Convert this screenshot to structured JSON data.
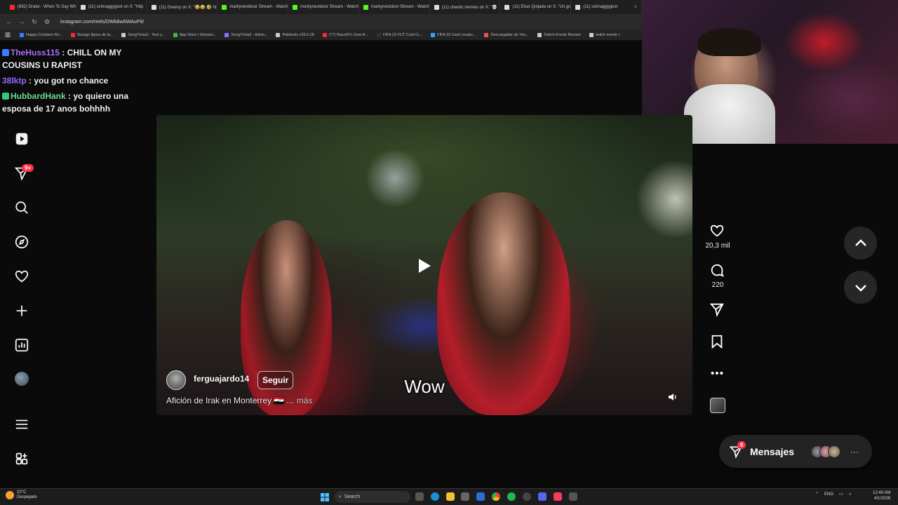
{
  "browser": {
    "tabs": [
      {
        "label": "(682) Drake - When To Say Wh",
        "icon_color": "#ff2a2a"
      },
      {
        "label": "(11) sshnaggygost on X: \"http",
        "icon_color": "#dddddd"
      },
      {
        "label": "(11) Greeny on X: \"😂😂 🤣 ht",
        "icon_color": "#dddddd"
      },
      {
        "label": "markynextdoor Stream - Watch",
        "icon_color": "#53fc18"
      },
      {
        "label": "markynextdoor Stream - Watch",
        "icon_color": "#53fc18"
      },
      {
        "label": "markynextdoor Stream - Watch",
        "icon_color": "#53fc18"
      },
      {
        "label": "(11) chaotic memes on X: \"💀",
        "icon_color": "#dddddd"
      },
      {
        "label": "(11) Elías Quijada on X: \"Un go",
        "icon_color": "#dddddd"
      },
      {
        "label": "(11) sshnaggygost",
        "icon_color": "#dddddd"
      }
    ],
    "url": "instagram.com/reels/DWkBw6WAuP8/",
    "bookmarks": [
      {
        "label": "Happy Cristiano Ro...",
        "icon_color": "#3d7cff"
      },
      {
        "label": "Burago figura de la...",
        "icon_color": "#ff2a2a"
      },
      {
        "label": "SongTrivia2 - Test y...",
        "icon_color": "#cccccc"
      },
      {
        "label": "App Store / Streami...",
        "icon_color": "#4caf50"
      },
      {
        "label": "SongTrivia2 - Advin...",
        "icon_color": "#8f6cff"
      },
      {
        "label": "Paletools v26.0.28",
        "icon_color": "#cccccc"
      },
      {
        "label": "(77) Razzi97s Zest-A...",
        "icon_color": "#ff2a2a"
      },
      {
        "label": "FIFA 23 FUT Card Cr...",
        "icon_color": "#333333"
      },
      {
        "label": "FIFA 23 Card creator...",
        "icon_color": "#3aa0ff"
      },
      {
        "label": "Descargador de You...",
        "icon_color": "#ff4a4a"
      },
      {
        "label": "Twitch Emote Resizer",
        "icon_color": "#cccccc"
      },
      {
        "label": "twitch emote r",
        "icon_color": "#cccccc"
      }
    ]
  },
  "chat": [
    {
      "user": "TheHuss115",
      "message": " : CHILL ON MY COUSINS U RAPIST"
    },
    {
      "user": "38lktp",
      "message": " : you got no chance"
    },
    {
      "user": "HubbardHank",
      "message": " : yo quiero una esposa de 17 anos bohhhh"
    }
  ],
  "sidebar": {
    "notifications_badge": "9+"
  },
  "reel": {
    "author": "ferguajardo14",
    "follow_label": "Seguir",
    "caption": "Afición de Irak en Monterrey 🇮🇶 ...",
    "more_label": "más",
    "subtitle": "Wow",
    "likes": "20,3 mil",
    "comments": "220"
  },
  "messages": {
    "label": "Mensajes",
    "badge": "6",
    "more": "···"
  },
  "taskbar": {
    "weather_temp": "22°C",
    "weather_desc": "Despejado",
    "search_label": "Search",
    "lang": "ENG",
    "time": "12:49 AM",
    "date": "4/1/2026"
  }
}
